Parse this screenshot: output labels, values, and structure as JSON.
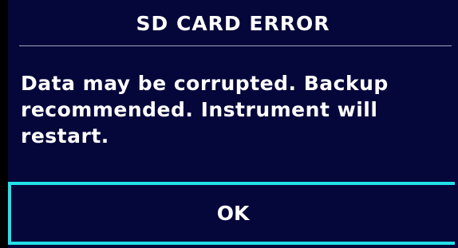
{
  "dialog": {
    "title": "SD CARD ERROR",
    "message": "Data may be corrupted. Backup recommended. Instrument will restart.",
    "ok_label": "OK"
  },
  "colors": {
    "background": "#05073a",
    "text": "#ffffff",
    "focus_border": "#22e0e8",
    "divider": "#9fa3bd"
  }
}
